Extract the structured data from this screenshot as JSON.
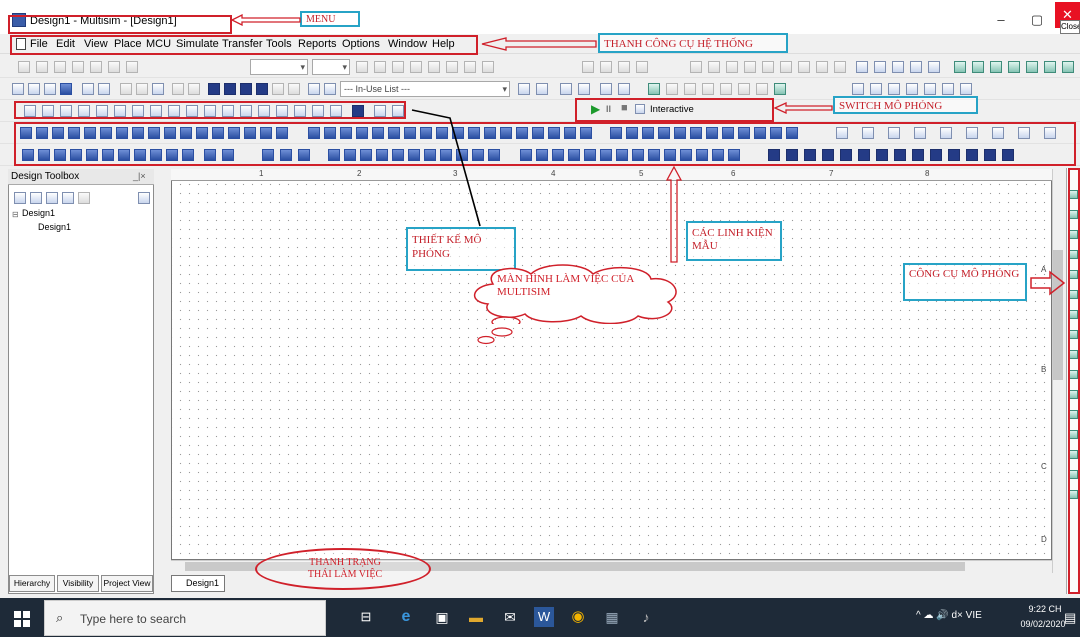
{
  "window": {
    "title": "Design1 - Multisim - [Design1]",
    "minimize_icon": "–",
    "maximize_icon": "▢",
    "close_icon": "✕",
    "close_tooltip": "Close"
  },
  "annotations": {
    "menu": "MENU",
    "system_toolbar": "THANH CÔNG CỤ HỆ THỐNG",
    "sim_switch": "SWITCH MÔ PHỎNG",
    "design_sim": "THIẾT KẾ MÔ PHỎNG",
    "components": "CÁC LINH KIỆN MẪU",
    "workspace": "MÀN HÌNH LÀM VIỆC CỦA MULTISIM",
    "sim_tools": "CÔNG CỤ MÔ PHỎNG",
    "status_bar": "THANH TRẠNG THÁI LÀM VIỆC"
  },
  "menu": {
    "items": [
      "File",
      "Edit",
      "View",
      "Place",
      "MCU",
      "Simulate",
      "Transfer",
      "Tools",
      "Reports",
      "Options",
      "Window",
      "Help"
    ]
  },
  "toolbar": {
    "inuse_list": "--- In-Use List ---",
    "interactive": "Interactive",
    "run_icon": "▶",
    "pause_icon": "II",
    "stop_icon": "■"
  },
  "design_toolbox": {
    "title": "Design Toolbox",
    "root": "Design1",
    "child": "Design1",
    "tabs": [
      "Hierarchy",
      "Visibility",
      "Project View"
    ]
  },
  "workspace": {
    "ruler_numbers": [
      "1",
      "2",
      "3",
      "4",
      "5",
      "6",
      "7",
      "8"
    ],
    "row_letters": [
      "A",
      "B",
      "C",
      "D"
    ],
    "design_tab": "Design1"
  },
  "taskbar": {
    "search_placeholder": "Type here to search",
    "tray_text": "^ ☁ 🔊 d× VIE",
    "time": "9:22 CH",
    "date": "09/02/2020"
  },
  "colors": {
    "annotation_red": "#d0202a",
    "annotation_cyan": "#27a3c6",
    "taskbar": "#1e2a38"
  }
}
